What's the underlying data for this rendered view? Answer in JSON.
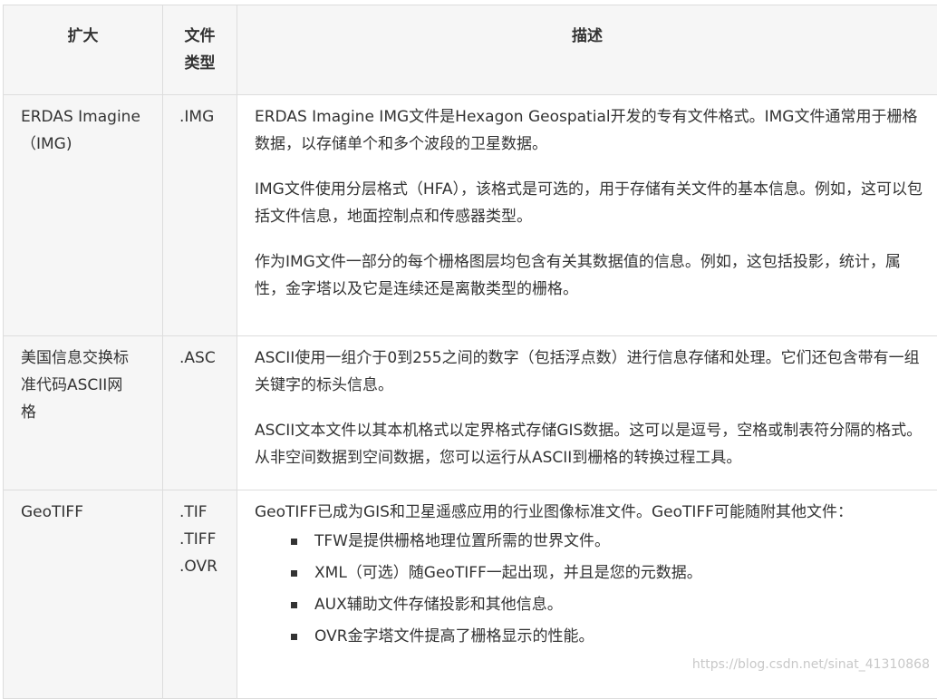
{
  "table": {
    "headers": {
      "ext": "扩大",
      "type_line1": "文件",
      "type_line2": "类型",
      "desc": "描述"
    },
    "rows": [
      {
        "ext_lines": [
          "ERDAS Imagine",
          "（IMG)"
        ],
        "types": [
          ".IMG"
        ],
        "paragraphs": [
          "ERDAS Imagine IMG文件是Hexagon Geospatial开发的专有文件格式。IMG文件通常用于栅格数据，以存储单个和多个波段的卫星数据。",
          "IMG文件使用分层格式（HFA），该格式是可选的，用于存储有关文件的基本信息。例如，这可以包括文件信息，地面控制点和传感器类型。",
          "作为IMG文件一部分的每个栅格图层均包含有关其数据值的信息。例如，这包括投影，统计，属性，金字塔以及它是连续还是离散类型的栅格。"
        ]
      },
      {
        "ext_lines": [
          "美国信息交换标",
          "准代码ASCII网",
          "格"
        ],
        "types": [
          ".ASC"
        ],
        "paragraphs": [
          "ASCII使用一组介于0到255之间的数字（包括浮点数）进行信息存储和处理。它们还包含带有一组关键字的标头信息。",
          "ASCII文本文件以其本机格式以定界格式存储GIS数据。这可以是逗号，空格或制表符分隔的格式。从非空间数据到空间数据，您可以运行从ASCII到栅格的转换过程工具。"
        ]
      },
      {
        "ext_lines": [
          "GeoTIFF"
        ],
        "types": [
          ".TIF",
          ".TIFF",
          ".OVR"
        ],
        "intro": "GeoTIFF已成为GIS和卫星遥感应用的行业图像标准文件。GeoTIFF可能随附其他文件：",
        "bullets": [
          "TFW是提供栅格地理位置所需的世界文件。",
          "XML（可选）随GeoTIFF一起出现，并且是您的元数据。",
          "AUX辅助文件存储投影和其他信息。",
          "OVR金字塔文件提高了栅格显示的性能。"
        ]
      }
    ]
  },
  "watermark": "https://blog.csdn.net/sinat_41310868"
}
